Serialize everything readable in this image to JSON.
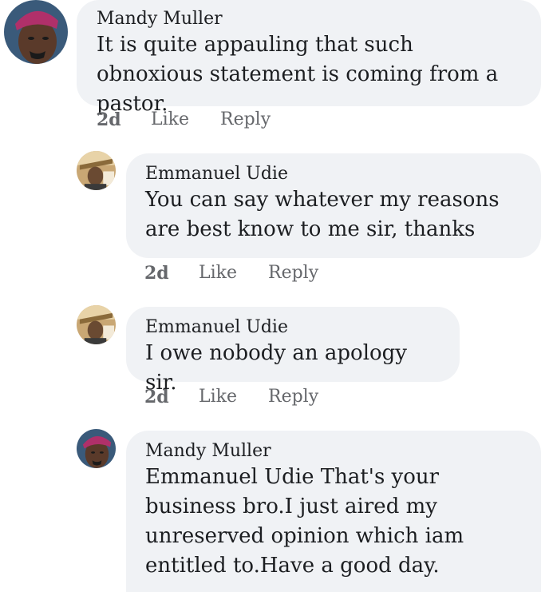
{
  "actions": {
    "like_label": "Like",
    "reply_label": "Reply"
  },
  "comments": [
    {
      "author": "Mandy Muller",
      "text": "It is quite appauling that such obnoxious statement is coming from a pastor.",
      "time": "2d",
      "avatar_icon": "user-avatar-icon"
    },
    {
      "author": "Emmanuel Udie",
      "text": "You can say whatever my reasons are best know to me sir, thanks",
      "time": "2d",
      "avatar_icon": "user-avatar-icon"
    },
    {
      "author": "Emmanuel Udie",
      "text": "I owe nobody an apology sir.",
      "time": "2d",
      "avatar_icon": "user-avatar-icon"
    },
    {
      "author": "Mandy Muller",
      "text": "Emmanuel Udie That's your business bro.I just aired my unreserved opinion which iam entitled to.Have a good day.",
      "avatar_icon": "user-avatar-icon"
    }
  ],
  "colors": {
    "bubble": "#f0f2f5",
    "text": "#1c1e21",
    "meta": "#65676b",
    "mandy_cap": "#b0306a",
    "mandy_skin": "#5a3a2a",
    "emmanuel_bg": "#c9a774"
  }
}
